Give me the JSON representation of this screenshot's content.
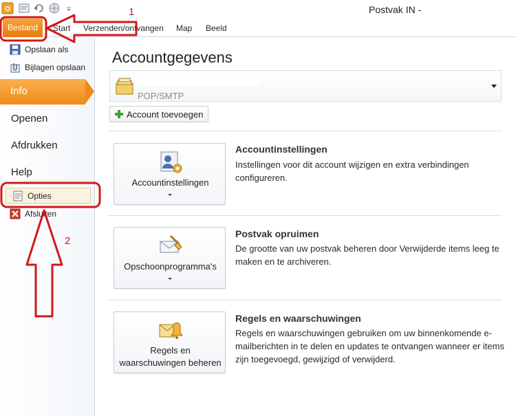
{
  "window": {
    "title": "Postvak IN -"
  },
  "ribbon": {
    "tabs": [
      {
        "label": "Bestand"
      },
      {
        "label": "Start"
      },
      {
        "label": "Verzenden/ontvangen"
      },
      {
        "label": "Map"
      },
      {
        "label": "Beeld"
      }
    ]
  },
  "nav": {
    "save_as": "Opslaan als",
    "save_attachments": "Bijlagen opslaan",
    "info": "Info",
    "open": "Openen",
    "print": "Afdrukken",
    "help": "Help",
    "options": "Opties",
    "exit": "Afsluiten"
  },
  "main": {
    "title": "Accountgegevens",
    "account_type": "POP/SMTP",
    "add_account": "Account toevoegen",
    "sections": [
      {
        "button_label": "Accountinstellingen",
        "title": "Accountinstellingen",
        "description": "Instellingen voor dit account wijzigen en extra verbindingen configureren."
      },
      {
        "button_label": "Opschoonprogramma's",
        "title": "Postvak opruimen",
        "description": "De grootte van uw postvak beheren door Verwijderde items leeg te maken en te archiveren."
      },
      {
        "button_label_line1": "Regels en",
        "button_label_line2": "waarschuwingen beheren",
        "title": "Regels en waarschuwingen",
        "description": "Regels en waarschuwingen gebruiken om uw binnenkomende e-mailberichten in te delen en updates te ontvangen wanneer er items zijn toegevoegd, gewijzigd of verwijderd."
      }
    ]
  },
  "annotations": {
    "step1": "1",
    "step2": "2"
  },
  "colors": {
    "accent_orange": "#f08a1a",
    "annotation_red": "#d01818"
  }
}
